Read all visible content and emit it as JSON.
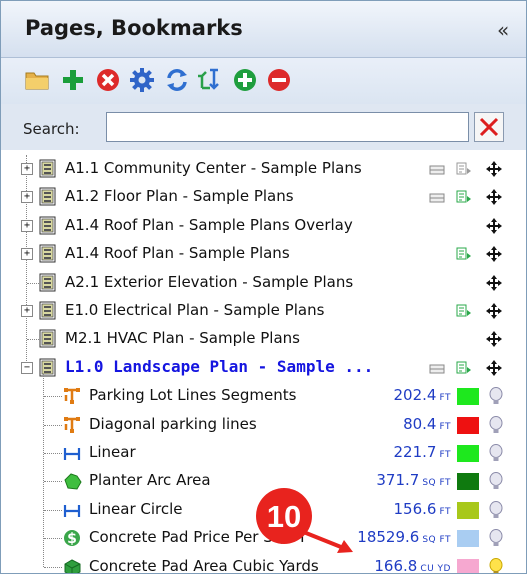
{
  "panel": {
    "title": "Pages, Bookmarks",
    "collapse_glyph": "«"
  },
  "toolbar": {
    "icons": [
      "folder-icon",
      "add-icon",
      "delete-icon",
      "settings-icon",
      "refresh-icon",
      "sort-icon",
      "expand-all-icon",
      "collapse-all-icon"
    ]
  },
  "search": {
    "label": "Search:",
    "value": "",
    "placeholder": ""
  },
  "tree": {
    "pages": [
      {
        "label": "A1.1 Community Center - Sample Plans",
        "expandable": true,
        "ruler": true,
        "stamp": "gray",
        "move": true
      },
      {
        "label": "A1.2 Floor Plan - Sample Plans",
        "expandable": true,
        "ruler": true,
        "stamp": "green",
        "move": true
      },
      {
        "label": "A1.4 Roof Plan - Sample Plans Overlay",
        "expandable": true,
        "ruler": false,
        "stamp": "none",
        "move": true
      },
      {
        "label": "A1.4 Roof Plan - Sample Plans",
        "expandable": true,
        "ruler": false,
        "stamp": "green",
        "move": true
      },
      {
        "label": "A2.1 Exterior Elevation - Sample Plans",
        "expandable": false,
        "ruler": false,
        "stamp": "none",
        "move": true
      },
      {
        "label": "E1.0 Electrical Plan - Sample Plans",
        "expandable": true,
        "ruler": false,
        "stamp": "green",
        "move": true
      },
      {
        "label": "M2.1 HVAC Plan - Sample Plans",
        "expandable": false,
        "ruler": false,
        "stamp": "none",
        "move": true
      },
      {
        "label": "L1.0 Landscape Plan - Sample ...",
        "expandable": true,
        "expanded": true,
        "ruler": true,
        "stamp": "green",
        "move": true
      }
    ],
    "takeoffs": [
      {
        "label": "Parking Lot Lines Segments",
        "value": "202.4",
        "unit": "FT",
        "color": "#1ee81e",
        "icon": "segments-icon",
        "bulb": "off"
      },
      {
        "label": "Diagonal parking lines",
        "value": "80.4",
        "unit": "FT",
        "color": "#ee1111",
        "icon": "segments-icon",
        "bulb": "off"
      },
      {
        "label": "Linear",
        "value": "221.7",
        "unit": "FT",
        "color": "#1ee81e",
        "icon": "linear-icon",
        "bulb": "off"
      },
      {
        "label": "Planter Arc Area",
        "value": "371.7",
        "unit": "SQ FT",
        "color": "#0f7a0f",
        "icon": "area-icon",
        "bulb": "off"
      },
      {
        "label": "Linear Circle",
        "value": "156.6",
        "unit": "FT",
        "color": "#a8c81a",
        "icon": "linear-icon",
        "bulb": "off"
      },
      {
        "label": "Concrete Pad Price Per SQ FT",
        "value": "18529.6",
        "unit": "SQ FT",
        "color": "#a9cdf2",
        "icon": "dollar-icon",
        "bulb": "off"
      },
      {
        "label": "Concrete Pad Area Cubic Yards",
        "value": "166.8",
        "unit": "CU YD",
        "color": "#f6a8d0",
        "icon": "volume-icon",
        "bulb": "on"
      }
    ]
  },
  "callout": {
    "number": "10",
    "color": "#e8231e"
  }
}
